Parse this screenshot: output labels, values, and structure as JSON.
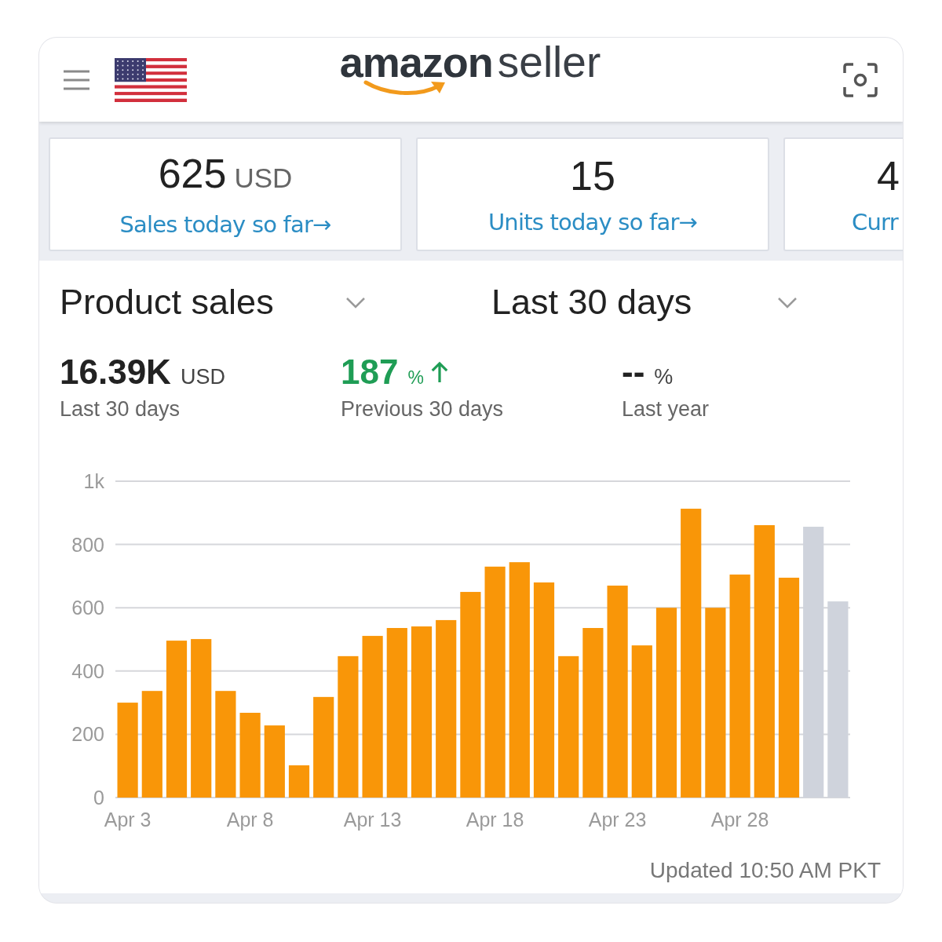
{
  "header": {
    "logo": {
      "brand": "amazon",
      "product": "seller"
    }
  },
  "cards": [
    {
      "value": "625",
      "unit": "USD",
      "label": "Sales today so far→"
    },
    {
      "value": "15",
      "label": "Units today so far→"
    },
    {
      "value": "4",
      "label": "Curr"
    }
  ],
  "selectors": [
    {
      "label": "Product sales"
    },
    {
      "label": "Last 30 days"
    }
  ],
  "stats": [
    {
      "value": "16.39K",
      "unit": "USD",
      "caption": "Last 30 days",
      "trend_up": false
    },
    {
      "value": "187",
      "unit": "%",
      "caption": "Previous 30 days",
      "trend_up": true
    },
    {
      "value": "--",
      "unit": "%",
      "caption": "Last year",
      "trend_up": false
    }
  ],
  "chart": {
    "chart_data": {
      "type": "bar",
      "categories": [
        "Apr 3",
        null,
        null,
        null,
        null,
        "Apr 8",
        null,
        null,
        null,
        null,
        "Apr 13",
        null,
        null,
        null,
        null,
        "Apr 18",
        null,
        null,
        null,
        null,
        "Apr 23",
        null,
        null,
        null,
        null,
        "Apr 28",
        null,
        null,
        null,
        null
      ],
      "series": [
        {
          "color": "#f99608",
          "values": [
            300,
            337,
            496,
            501,
            337,
            268,
            228,
            102,
            318,
            447,
            511,
            536,
            541,
            561,
            650,
            730,
            744,
            680,
            447,
            536,
            670,
            481,
            600,
            913,
            600,
            705,
            861,
            695,
            null,
            null
          ]
        },
        {
          "color": "#cfd3dc",
          "values": [
            null,
            null,
            null,
            null,
            null,
            null,
            null,
            null,
            null,
            null,
            null,
            null,
            null,
            null,
            null,
            null,
            null,
            null,
            null,
            null,
            null,
            null,
            null,
            null,
            null,
            null,
            null,
            null,
            856,
            620
          ]
        }
      ],
      "stacked": true,
      "grid": true,
      "ylim": [
        0,
        1000
      ],
      "yticks": [
        0,
        200,
        400,
        600,
        800,
        {
          "value": 1000,
          "label": "1k"
        }
      ]
    },
    "updated": "Updated 10:50 AM PKT"
  }
}
